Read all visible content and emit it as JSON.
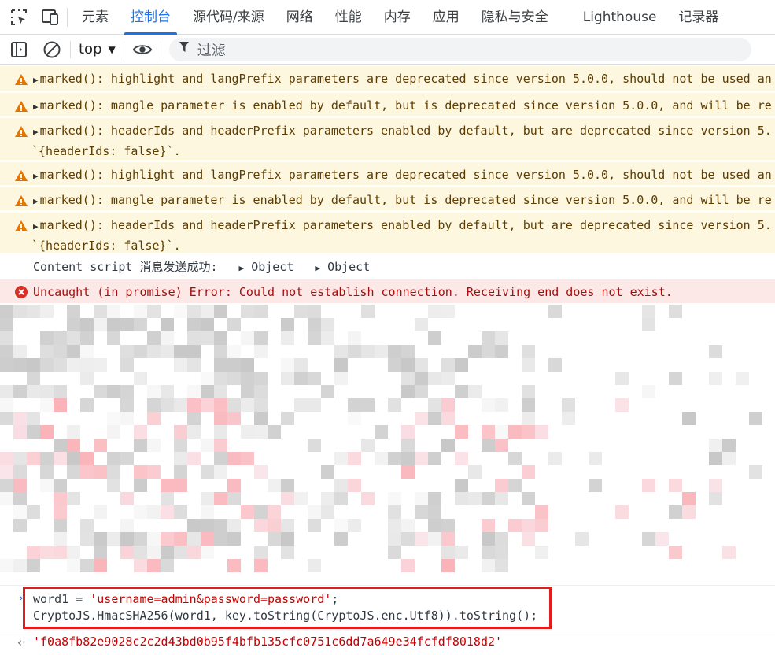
{
  "tabs": [
    {
      "label": "元素",
      "active": false
    },
    {
      "label": "控制台",
      "active": true
    },
    {
      "label": "源代码/来源",
      "active": false
    },
    {
      "label": "网络",
      "active": false
    },
    {
      "label": "性能",
      "active": false
    },
    {
      "label": "内存",
      "active": false
    },
    {
      "label": "应用",
      "active": false
    },
    {
      "label": "隐私与安全",
      "active": false
    },
    {
      "label": "Lighthouse",
      "active": false
    },
    {
      "label": "记录器",
      "active": false
    }
  ],
  "toolbar": {
    "context": "top",
    "filter_placeholder": "过滤"
  },
  "messages": {
    "warn1": "marked(): highlight and langPrefix parameters are deprecated since version 5.0.0, should not be used an",
    "warn2": "marked(): mangle parameter is enabled by default, but is deprecated since version 5.0.0, and will be re",
    "warn3_line1": "marked(): headerIds and headerPrefix parameters enabled by default, but are deprecated since version 5.",
    "warn3_line2": "`{headerIds: false}`.",
    "warn4": "marked(): highlight and langPrefix parameters are deprecated since version 5.0.0, should not be used an",
    "warn5": "marked(): mangle parameter is enabled by default, but is deprecated since version 5.0.0, and will be re",
    "warn6_line1": "marked(): headerIds and headerPrefix parameters enabled by default, but are deprecated since version 5.",
    "warn6_line2": "`{headerIds: false}`.",
    "log_text": "Content script 消息发送成功:",
    "log_obj1": "Object",
    "log_obj2": "Object",
    "error": "Uncaught (in promise) Error: Could not establish connection. Receiving end does not exist."
  },
  "input": {
    "line1_prefix": "word1 = ",
    "line1_string": "'username=admin&password=password'",
    "line1_suffix": ";",
    "line2": "CryptoJS.HmacSHA256(word1, key.toString(CryptoJS.enc.Utf8)).toString();"
  },
  "result": {
    "value": "'f0a8fb82e9028c2c2d43bd0b95f4bfb135cfc0751c6dd7a649e34fcfdf8018d2'"
  },
  "colors": {
    "accent": "#1a73e8",
    "warning_bg": "#fef7e0",
    "error_bg": "#fce8e6",
    "string": "#c80000",
    "highlight_box": "#e01e1e"
  }
}
